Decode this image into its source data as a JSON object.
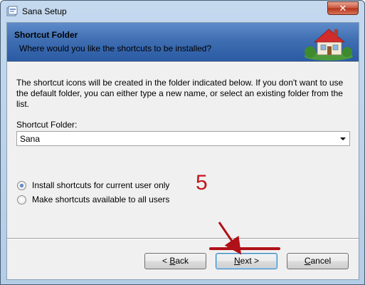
{
  "window": {
    "title": "Sana Setup"
  },
  "banner": {
    "title": "Shortcut Folder",
    "subtitle": "Where would you like the shortcuts to be installed?"
  },
  "description": "The shortcut icons will be created in the folder indicated below. If you don't want to use the default folder, you can either type a new name, or select an existing folder from the list.",
  "shortcut_folder": {
    "label": "Shortcut Folder:",
    "value": "Sana"
  },
  "options": [
    {
      "label": "Install shortcuts for current user only",
      "checked": true
    },
    {
      "label": "Make shortcuts available to all users",
      "checked": false
    }
  ],
  "buttons": {
    "back": {
      "prefix": "< ",
      "mnemonic": "B",
      "rest": "ack"
    },
    "next": {
      "mnemonic": "N",
      "rest": "ext >"
    },
    "cancel": {
      "mnemonic": "C",
      "rest": "ancel"
    }
  },
  "annotation": {
    "step_number": "5",
    "color": "#c0161c"
  },
  "colors": {
    "banner": "#3f6eb2",
    "close": "#c9553b"
  }
}
